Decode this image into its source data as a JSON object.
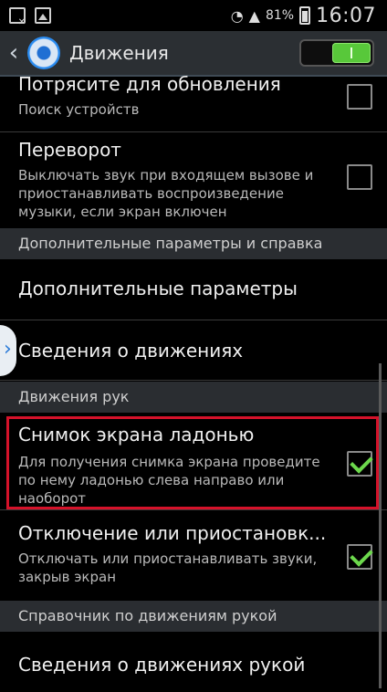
{
  "status_bar": {
    "battery_percent": "81%",
    "time": "16:07"
  },
  "header": {
    "title": "Движения",
    "toggle_state": "on"
  },
  "items": {
    "shake": {
      "title": "Потрясите для обновления",
      "subtitle": "Поиск устройств",
      "checked": false
    },
    "flip": {
      "title": "Переворот",
      "subtitle": "Выключать звук при входящем вызове и приостанавливать воспроизведение музыки, если экран включен",
      "checked": false
    },
    "section_additional": "Дополнительные параметры и справка",
    "additional_params": "Дополнительные параметры",
    "motion_info": "Сведения о движениях",
    "section_hand": "Движения рук",
    "palm_capture": {
      "title": "Снимок экрана ладонью",
      "subtitle": "Для получения снимка экрана проведите по нему ладонью слева направо или наоборот",
      "checked": true
    },
    "palm_mute": {
      "title": "Отключение или приостановк...",
      "subtitle": "Отключать или приостанавливать звуки, закрыв экран",
      "checked": true
    },
    "section_guide": "Справочник по движениям рукой",
    "hand_motion_info": "Сведения о движениях рукой"
  },
  "colors": {
    "accent_green": "#6cd84c",
    "highlight_red": "#d5122a",
    "header_bg": "#2b2f33",
    "section_bg": "#2a2d31"
  }
}
